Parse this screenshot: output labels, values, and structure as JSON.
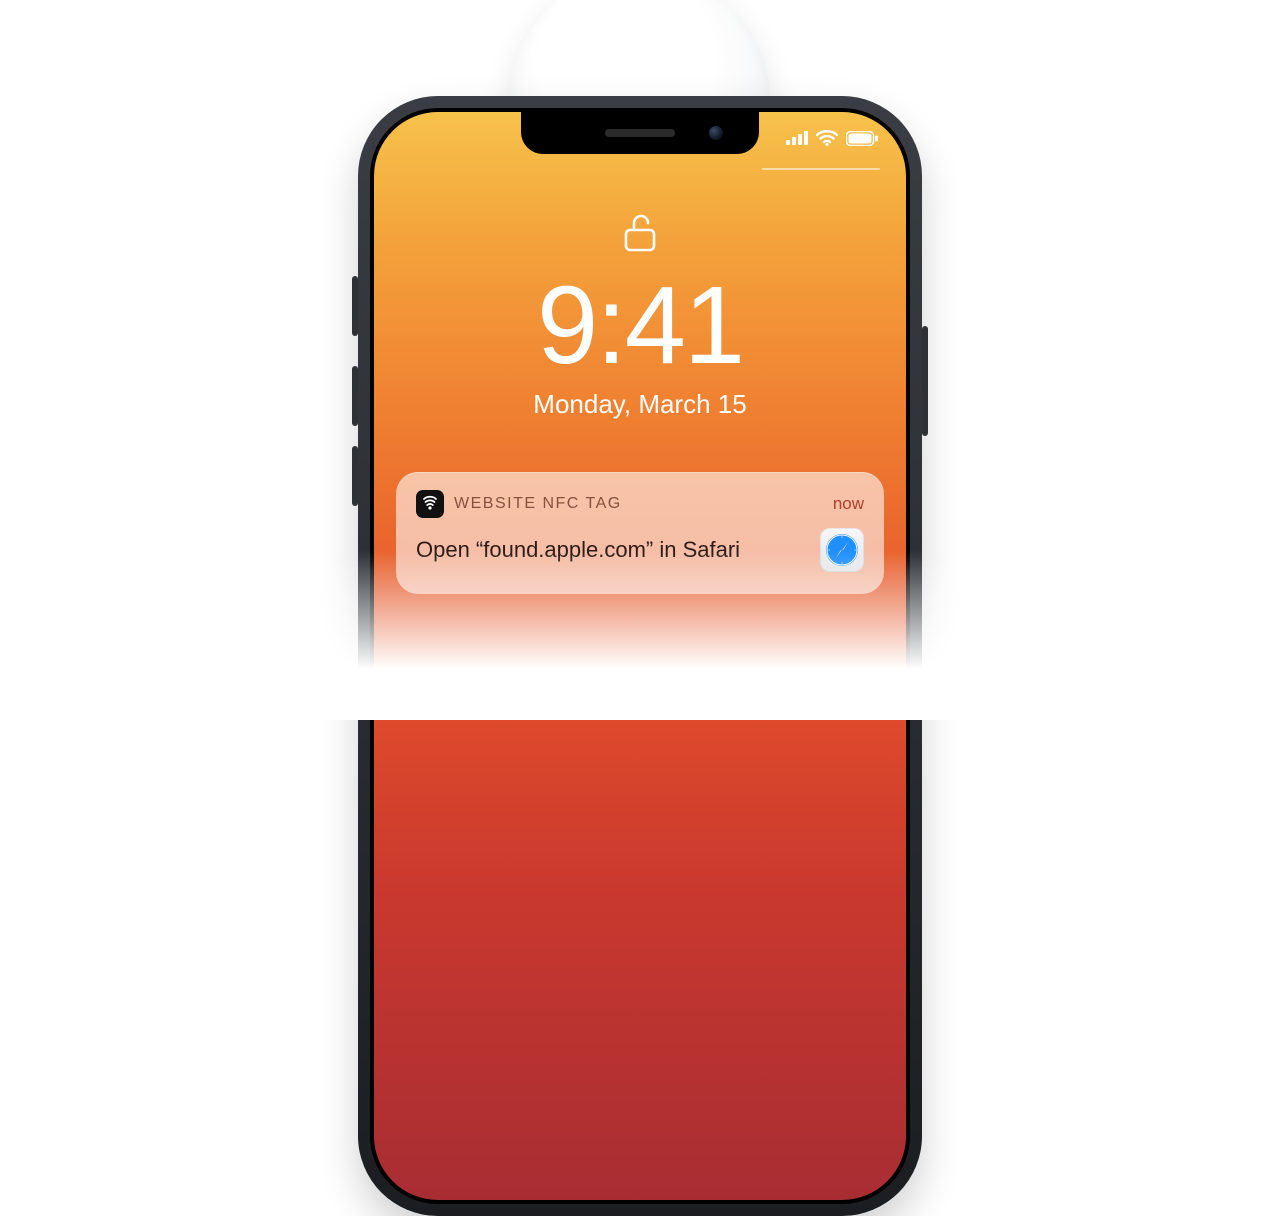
{
  "lockscreen": {
    "time": "9:41",
    "date": "Monday, March 15"
  },
  "notification": {
    "source": "WEBSITE NFC TAG",
    "when": "now",
    "body": "Open “found.apple.com” in Safari"
  },
  "icons": {
    "lock": "unlock-icon",
    "signal": "cellular-signal-icon",
    "wifi": "wifi-icon",
    "battery": "battery-icon",
    "nfc": "nfc-icon",
    "safari": "safari-icon"
  }
}
